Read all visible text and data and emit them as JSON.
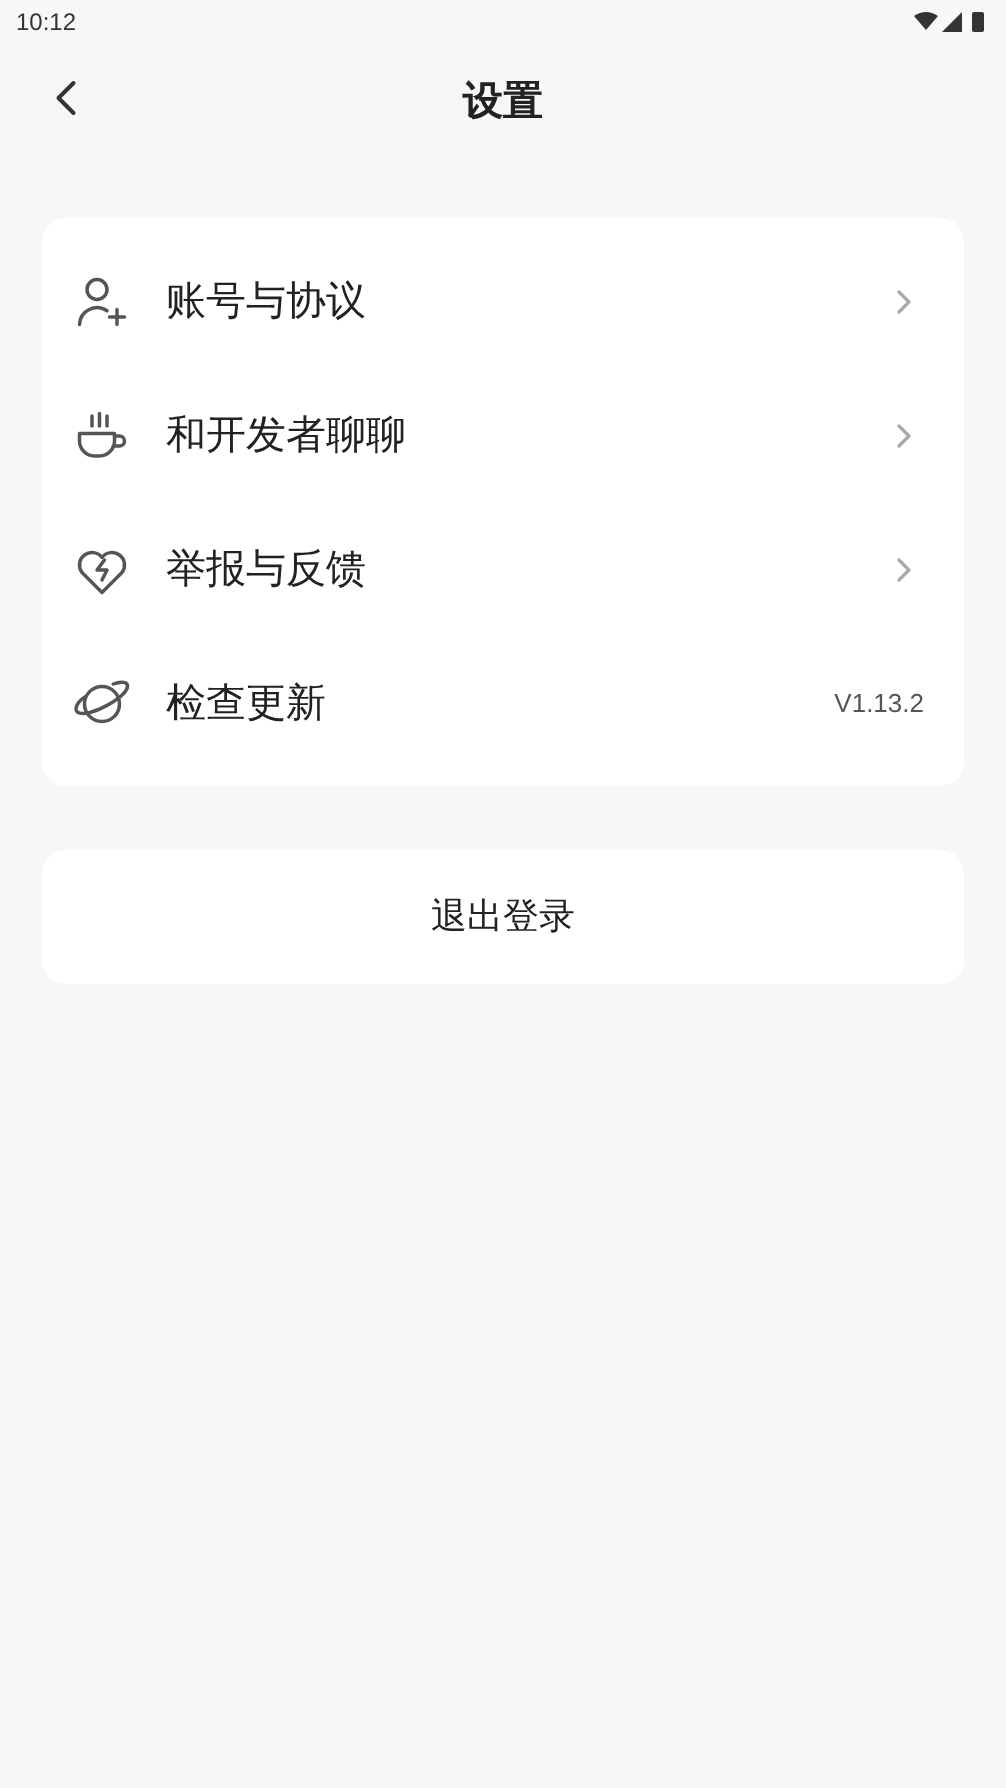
{
  "status_bar": {
    "time": "10:12"
  },
  "header": {
    "title": "设置"
  },
  "menu": [
    {
      "label": "账号与协议",
      "kind": "link"
    },
    {
      "label": "和开发者聊聊",
      "kind": "link"
    },
    {
      "label": "举报与反馈",
      "kind": "link"
    },
    {
      "label": "检查更新",
      "kind": "value",
      "value": "V1.13.2"
    }
  ],
  "logout_button": "退出登录"
}
